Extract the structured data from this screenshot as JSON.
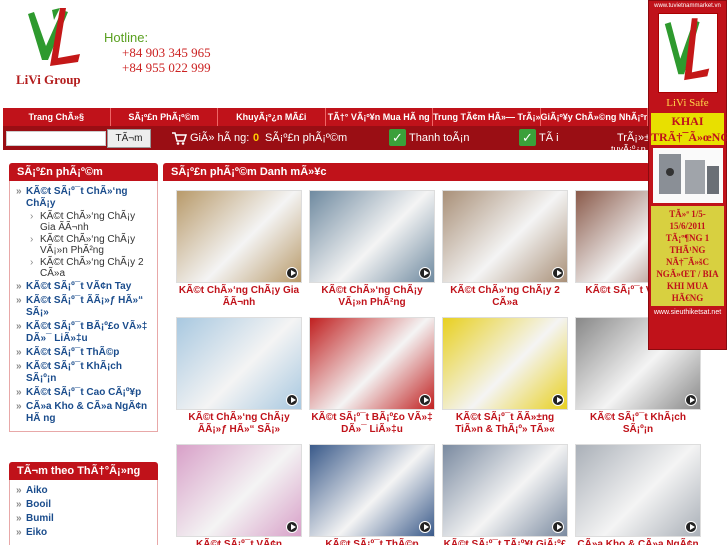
{
  "header": {
    "group_name": "LiVi Group",
    "hotline_label": "Hotline:",
    "phones": [
      "+84 903 345 965",
      "+84 955 022 999"
    ]
  },
  "nav": [
    "Trang ChÃ»§",
    "SÃ¡º£n PhÃ¡º©m",
    "KhuyÃ¡º¿n MÃ£i",
    "TÃ†° VÃ¡º¥n Mua HÃ ng",
    "Trung TÃ¢m HÃ»— TrÃ¡»£",
    "GiÃ¡º¥y ChÃ»©ng NhÃ¡º­n"
  ],
  "searchbar": {
    "search_button": "TÃ¬m",
    "cart_label": "GiÃ»  hÃ ng:",
    "cart_count": "0",
    "cart_unit": "SÃ¡º£n phÃ¡º©m",
    "payment": "Thanh toÃ¡n",
    "tai": "TÃ i",
    "extra": "TrÃ¡»±",
    "extra2": "tuyÃ¡º¿n"
  },
  "sidebar": {
    "title": "SÃ¡º£n phÃ¡º©m",
    "categories": [
      {
        "label": "KÃ©t SÃ¡º¯t ChÃ»‘ng ChÃ¡y",
        "subs": [
          "KÃ©t ChÃ»‘ng ChÃ¡y Gia ÃÃ¬nh",
          "KÃ©t ChÃ»‘ng ChÃ¡y VÃ¡»n PhÃ²ng",
          "KÃ©t ChÃ»‘ng ChÃ¡y 2 CÃ»a"
        ]
      },
      {
        "label": "KÃ©t SÃ¡º¯t VÃ¢n Tay",
        "subs": []
      },
      {
        "label": "KÃ©t SÃ¡º¯t ÃÃ¡»ƒ HÃ»“ SÃ¡»",
        "subs": []
      },
      {
        "label": "KÃ©t SÃ¡º¯t BÃ¡º£o VÃ»‡ DÃ»¯ LiÃ»‡u",
        "subs": []
      },
      {
        "label": "KÃ©t SÃ¡º¯t ThÃ©p",
        "subs": []
      },
      {
        "label": "KÃ©t SÃ¡º¯t KhÃ¡ch SÃ¡º¡n",
        "subs": []
      },
      {
        "label": "KÃ©t SÃ¡º¯t Cao CÃ¡º¥p",
        "subs": []
      },
      {
        "label": "CÃ»a Kho & CÃ»a NgÃ¢n HÃ ng",
        "subs": []
      }
    ]
  },
  "brands": {
    "title": "TÃ¬m theo ThÃ†°Ã¡»ng",
    "items": [
      "Aiko",
      "Booil",
      "Bumil",
      "Eiko"
    ]
  },
  "main": {
    "title": "SÃ¡º£n phÃ¡º©m Danh mÃ»¥c",
    "products": [
      {
        "caption": "KÃ©t ChÃ»‘ng ChÃ¡y Gia ÃÃ¬nh",
        "color": "#b89a6a"
      },
      {
        "caption": "KÃ©t ChÃ»‘ng ChÃ¡y VÃ¡»n PhÃ²ng",
        "color": "#6f8aa0"
      },
      {
        "caption": "KÃ©t ChÃ»‘ng ChÃ¡y 2 CÃ»a",
        "color": "#a99078"
      },
      {
        "caption": "KÃ©t SÃ¡º¯t VÃ¢n Tay",
        "color": "#8a5a4a"
      },
      {
        "caption": "KÃ©t ChÃ»‘ng ChÃ¡y ÃÃ¡»ƒ HÃ»“ SÃ¡»",
        "color": "#a8c8e0"
      },
      {
        "caption": "KÃ©t SÃ¡º¯t BÃ¡º£o VÃ»‡ DÃ»¯ LiÃ»‡u",
        "color": "#c02020"
      },
      {
        "caption": "KÃ©t SÃ¡º¯t ÃÃ»±ng TiÃ»n & ThÃ¡º» TÃ»«",
        "color": "#e8d020"
      },
      {
        "caption": "KÃ©t SÃ¡º¯t KhÃ¡ch SÃ¡º¡n",
        "color": "#888888"
      },
      {
        "caption": "KÃ©t SÃ¡º¯t VÃ¢n TÃ†°Ã¡»ng",
        "color": "#d8a0c8"
      },
      {
        "caption": "KÃ©t SÃ¡º¯t ThÃ©p",
        "color": "#3a5a8a"
      },
      {
        "caption": "KÃ©t SÃ¡º¯t TÃ¡º¥t GiÃ¡º£",
        "color": "#7a8aa0"
      },
      {
        "caption": "CÃ»a Kho & CÃ»a NgÃ¢n",
        "color": "#aab0b8"
      }
    ]
  },
  "banner": {
    "url": "www.tuvietnammarket.vn",
    "name": "LiVi Safe",
    "headline": "KHAI TRÃ†¯Ã»œNG",
    "promo_lines": [
      "TÃ»ª 1/5-15/6/2011",
      "TÃ¡º¶NG 1 THÃ¹NG",
      "NÃ†¯Ã»šC NGÃ»ŒT / BIA",
      "KHI MUA HÃ€NG"
    ],
    "url_bottom": "www.sieuthiketsat.net"
  }
}
